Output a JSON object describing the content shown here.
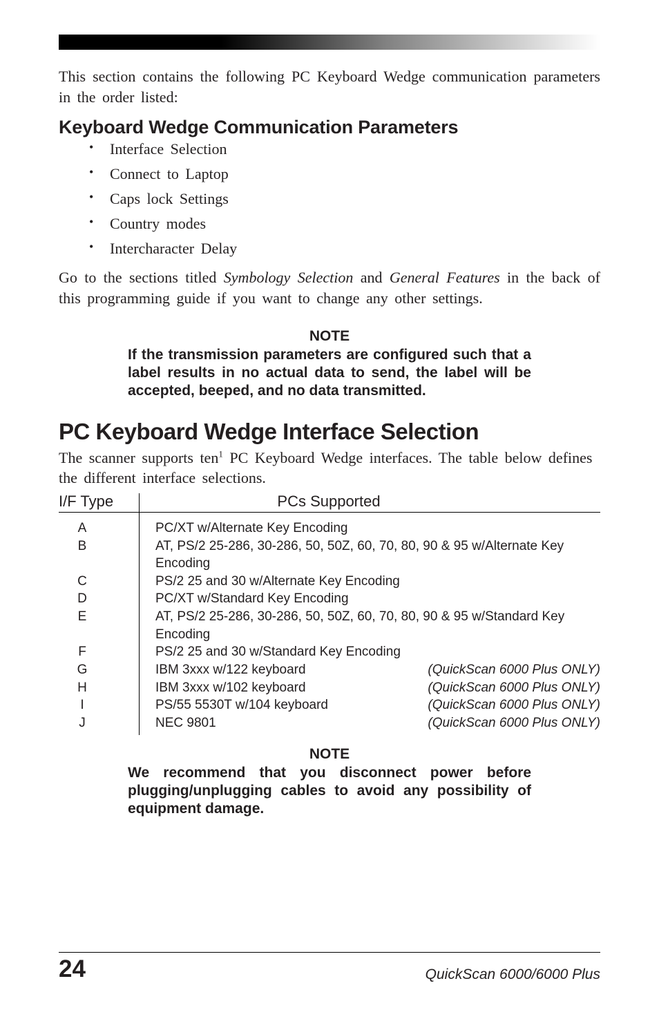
{
  "top": {},
  "intro": "This section contains the following PC Keyboard Wedge communication parameters in the order listed:",
  "section": {
    "title": "Keyboard Wedge Communication Parameters",
    "items": [
      "Interface Selection",
      "Connect to Laptop",
      "Caps lock Settings",
      "Country modes",
      "Intercharacter Delay"
    ]
  },
  "after_list_p1": "Go to the sections titled ",
  "after_list_i1": "Symbology Selection",
  "after_list_mid": " and ",
  "after_list_i2": "General Features",
  "after_list_p2": " in the back of this programming guide if you want to change any other settings.",
  "note1": {
    "title": "NOTE",
    "body": "If the transmission parameters are configured such that a label results in no actual data to send, the label will be accepted, beeped, and no data transmitted."
  },
  "h1": "PC Keyboard Wedge Interface Selection",
  "sub_body_pre": "The scanner supports ten",
  "sub_body_sup": "1",
  "sub_body_post": " PC Keyboard Wedge interfaces. The table below defines the different interface selections.",
  "table": {
    "h1": "I/F Type",
    "h2": "PCs Supported",
    "rows": [
      {
        "type": "A",
        "desc": "PC/XT w/Alternate Key Encoding",
        "note": ""
      },
      {
        "type": "B",
        "desc": "AT, PS/2 25-286, 30-286, 50, 50Z, 60, 70, 80, 90 & 95 w/Alternate Key Encoding",
        "note": ""
      },
      {
        "type": "C",
        "desc": "PS/2 25 and 30 w/Alternate Key Encoding",
        "note": ""
      },
      {
        "type": "D",
        "desc": "PC/XT w/Standard Key Encoding",
        "note": ""
      },
      {
        "type": "E",
        "desc": "AT, PS/2 25-286, 30-286, 50, 50Z, 60, 70, 80, 90 & 95 w/Standard Key Encoding",
        "note": ""
      },
      {
        "type": "F",
        "desc": "PS/2 25 and 30 w/Standard Key Encoding",
        "note": ""
      },
      {
        "type": "G",
        "desc": "IBM 3xxx w/122 keyboard",
        "note": "(QuickScan 6000 Plus ONLY)"
      },
      {
        "type": "H",
        "desc": "IBM 3xxx w/102 keyboard",
        "note": "(QuickScan 6000 Plus ONLY)"
      },
      {
        "type": "I",
        "desc": "PS/55 5530T w/104 keyboard",
        "note": "(QuickScan 6000 Plus ONLY)"
      },
      {
        "type": "J",
        "desc": "NEC 9801",
        "note": "(QuickScan 6000 Plus ONLY)"
      }
    ]
  },
  "note2": {
    "title": "NOTE",
    "body": "We recommend that you disconnect power before plugging/unplugging cables to avoid any possibility of equipment damage."
  },
  "footer": {
    "page": "24",
    "model": "QuickScan 6000/6000 Plus"
  }
}
